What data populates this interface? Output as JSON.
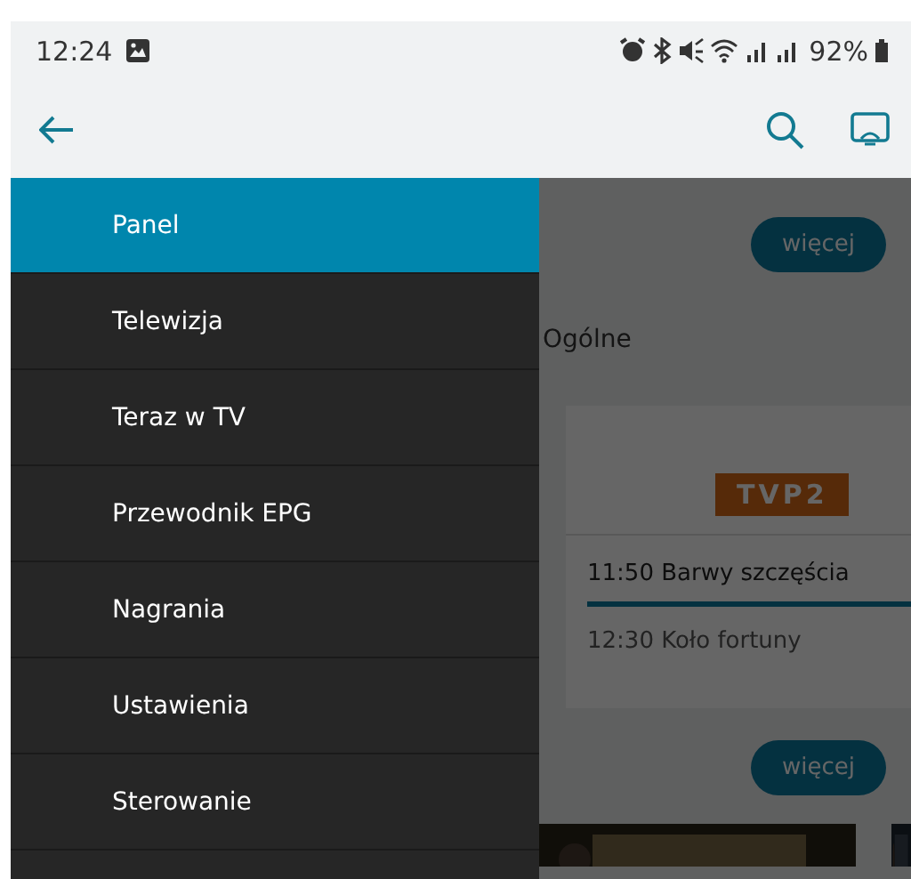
{
  "status_bar": {
    "time": "12:24",
    "battery": "92%"
  },
  "content": {
    "more_button": "więcej",
    "tabs": [
      {
        "label": "Ogólne",
        "selected": false
      }
    ],
    "channels": [
      {
        "logo": "TVP2",
        "current": "11:50 Barwy szczęścia",
        "level": 1,
        "next": "12:30 Koło fortuny"
      }
    ],
    "recordings_more": "więcej"
  },
  "drawer": {
    "items": [
      {
        "label": "Panel",
        "selected": true
      },
      {
        "label": "Telewizja",
        "selected": false
      },
      {
        "label": "Teraz w TV",
        "selected": false
      },
      {
        "label": "Przewodnik EPG",
        "selected": false
      },
      {
        "label": "Nagrania",
        "selected": false
      },
      {
        "label": "Ustawienia",
        "selected": false
      },
      {
        "label": "Sterowanie",
        "selected": false
      }
    ]
  }
}
